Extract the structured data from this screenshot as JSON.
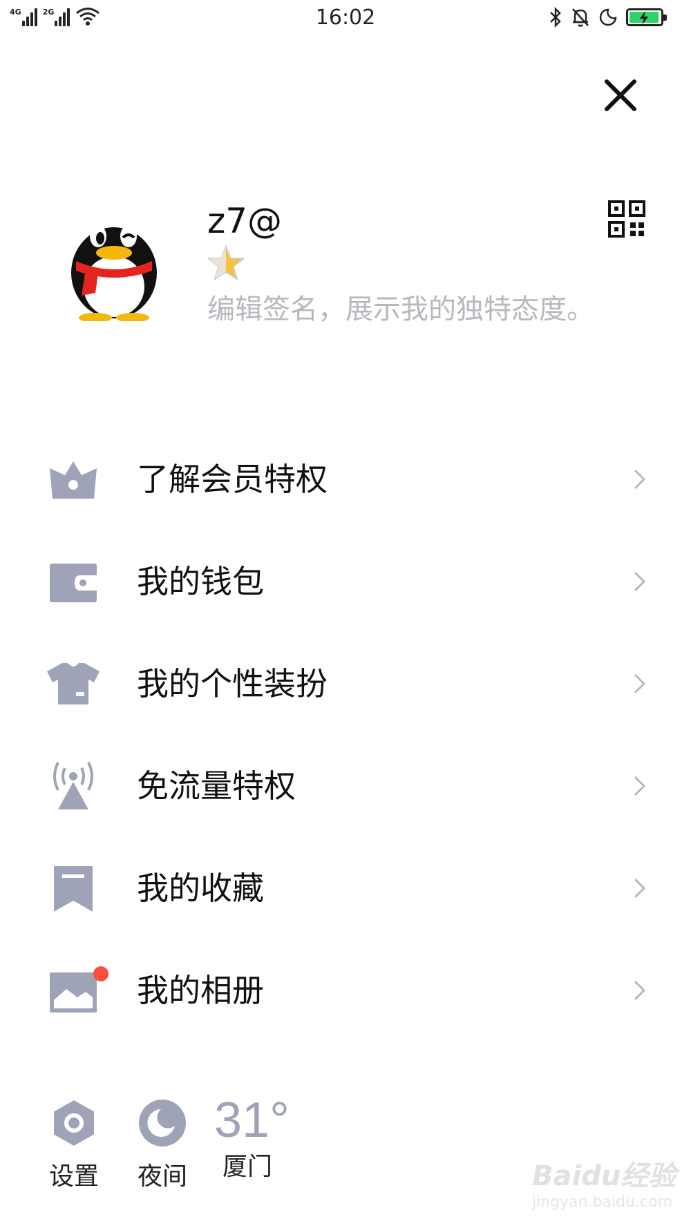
{
  "status_bar": {
    "net1": "4G",
    "net2": "2G",
    "time": "16:02",
    "battery_color": "#2fd26b"
  },
  "header": {
    "close_icon": "close-icon",
    "qr_icon": "qr-code-icon"
  },
  "profile": {
    "name": "z7@",
    "signature": "编辑签名，展示我的独特态度。",
    "avatar_icon": "qq-penguin-avatar",
    "level_icon": "star-icon"
  },
  "menu": {
    "icon_color": "#9ea3b8",
    "items": [
      {
        "label": "了解会员特权",
        "icon": "crown-icon"
      },
      {
        "label": "我的钱包",
        "icon": "wallet-icon"
      },
      {
        "label": "我的个性装扮",
        "icon": "shirt-icon"
      },
      {
        "label": "免流量特权",
        "icon": "broadcast-tower-icon"
      },
      {
        "label": "我的收藏",
        "icon": "bookmark-icon"
      },
      {
        "label": "我的相册",
        "icon": "album-icon",
        "badge_color": "#f4503c"
      }
    ]
  },
  "bottom_bar": {
    "settings_label": "设置",
    "night_label": "夜间",
    "weather_temp": "31°",
    "weather_city": "厦门"
  },
  "watermark": {
    "text": "Baidu经验",
    "sub": "jingyan.baidu.com"
  }
}
